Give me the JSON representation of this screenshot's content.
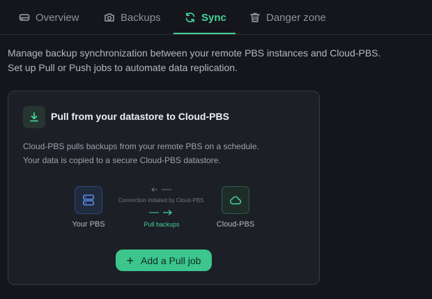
{
  "tabs": [
    {
      "label": "Overview",
      "icon": "drive-icon",
      "active": false
    },
    {
      "label": "Backups",
      "icon": "camera-icon",
      "active": false
    },
    {
      "label": "Sync",
      "icon": "sync-icon",
      "active": true
    },
    {
      "label": "Danger zone",
      "icon": "trash-icon",
      "active": false
    }
  ],
  "intro": {
    "line1": "Manage backup synchronization between your remote PBS instances and Cloud-PBS.",
    "line2": "Set up Pull or Push jobs to automate data replication."
  },
  "card": {
    "title": "Pull from your datastore to Cloud-PBS",
    "desc_line1": "Cloud-PBS pulls backups from your remote PBS on a schedule.",
    "desc_line2": "Your data is copied to a secure Cloud-PBS datastore.",
    "source_label": "Your PBS",
    "target_label": "Cloud-PBS",
    "connection_text": "Connection initiated by Cloud-PBS",
    "pull_text": "Pull backups",
    "add_button": "Add a Pull job"
  },
  "colors": {
    "accent": "#45d29a",
    "button": "#3cc58c",
    "pbs_blue": "#5b8dea",
    "background": "#15161c",
    "card": "#1d1f26"
  }
}
